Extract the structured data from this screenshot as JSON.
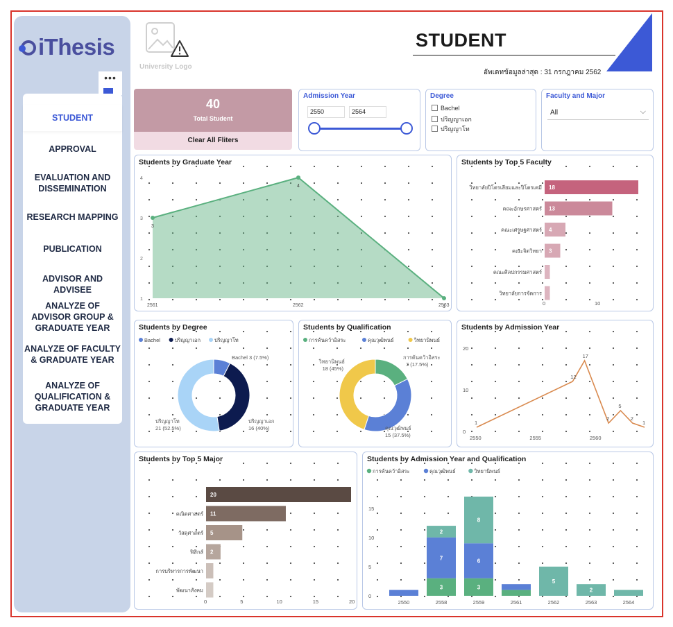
{
  "app": {
    "logo_text": "iThesis",
    "more_label": "•••",
    "university_logo": "University Logo",
    "page_title": "STUDENT",
    "updated_text": "อัพเดทข้อมูลล่าสุด : 31 กรกฎาคม 2562"
  },
  "nav": [
    {
      "label": "STUDENT",
      "active": true
    },
    {
      "label": "APPROVAL"
    },
    {
      "label": "EVALUATION AND DISSEMINATION"
    },
    {
      "label": "RESEARCH MAPPING"
    },
    {
      "label": "PUBLICATION"
    },
    {
      "label": "ADVISOR AND ADVISEE"
    },
    {
      "label": "ANALYZE OF ADVISOR GROUP & GRADUATE YEAR"
    },
    {
      "label": "ANALYZE OF FACULTY & GRADUATE YEAR"
    },
    {
      "label": "ANALYZE OF QUALIFICATION & GRADUATE YEAR"
    }
  ],
  "kpi": {
    "value": "40",
    "label": "Total Student",
    "clear_label": "Clear All Fliters"
  },
  "filters": {
    "admission": {
      "title": "Admission Year",
      "from": "2550",
      "to": "2564"
    },
    "degree": {
      "title": "Degree",
      "options": [
        "Bachel",
        "ปริญญาเอก",
        "ปริญญาโท"
      ]
    },
    "faculty": {
      "title": "Faculty and Major",
      "value": "All"
    }
  },
  "colors": {
    "accent": "#3c59d6",
    "kpi": "#c39aa5",
    "green": "#5ab07f",
    "navy": "#0d1b4f",
    "lightblue": "#a9d4f7",
    "blue": "#5b80d6",
    "yellow": "#f0c84a",
    "teal": "#6fb7a9",
    "orange": "#d98a4f",
    "brown": "#5a4a43"
  },
  "chart_data": [
    {
      "id": "graduate",
      "type": "area",
      "title": "Students by Graduate Year",
      "x": [
        "2561",
        "2562",
        "2563"
      ],
      "values": [
        3,
        4,
        1
      ],
      "yticks": [
        "1",
        "2",
        "3",
        "4"
      ],
      "ylim": [
        1,
        4
      ]
    },
    {
      "id": "faculty",
      "type": "bar",
      "orientation": "horizontal",
      "title": "Students by Top 5 Faculty",
      "categories": [
        "วิทยาลัยปิโตรเลียมและปิโตรเคมี",
        "คณะอักษรศาสตร์",
        "คณะเศรษฐศาสตร์",
        "คณะจิตวิทยา",
        "คณะศิลปกรรมศาสตร์",
        "วิทยาลัยการจัดการ"
      ],
      "values": [
        18,
        13,
        4,
        3,
        1,
        1
      ],
      "labels": [
        "18",
        "13",
        "4",
        "3",
        "",
        ""
      ],
      "xticks": [
        "0",
        "10"
      ],
      "xlim": [
        0,
        20
      ]
    },
    {
      "id": "degree",
      "type": "pie",
      "title": "Students by Degree",
      "legend": [
        "Bachel",
        "ปริญญาเอก",
        "ปริญญาโท"
      ],
      "values": [
        3,
        16,
        21
      ],
      "labels": [
        "Bachel 3 (7.5%)",
        "ปริญญาเอก",
        "16 (40%)",
        "ปริญญาโท",
        "21 (52.5%)"
      ]
    },
    {
      "id": "qualification",
      "type": "pie",
      "title": "Students by Qualification",
      "legend": [
        "การค้นคว้าอิสระ",
        "คุณวุฒิพนธ์",
        "วิทยานิพนธ์"
      ],
      "values": [
        7,
        15,
        18
      ],
      "labels": [
        "การค้นคว้าอิสระ",
        "7 (17.5%)",
        "คุณวุฒิพนธ์",
        "15 (37.5%)",
        "วิทยานิพนธ์",
        "18 (45%)"
      ]
    },
    {
      "id": "admission",
      "type": "line",
      "title": "Students by Admission Year",
      "x": [
        2550,
        2558,
        2559,
        2561,
        2562,
        2563,
        2564
      ],
      "values": [
        1,
        12,
        17,
        2,
        5,
        2,
        1
      ],
      "labels": [
        "1",
        "12",
        "17",
        "2",
        "5",
        "2",
        "1"
      ],
      "xticks": [
        "2550",
        "2555",
        "2560"
      ],
      "yticks": [
        "0",
        "10",
        "20"
      ],
      "ylim": [
        0,
        20
      ]
    },
    {
      "id": "major",
      "type": "bar",
      "orientation": "horizontal",
      "title": "Students by Top 5 Major",
      "categories": [
        "",
        "คณิตศาสตร์",
        "วัสดุศาสตร์",
        "ฟิสิกส์",
        "การบริหารการพัฒนา",
        "พัฒนาสังคม"
      ],
      "values": [
        20,
        11,
        5,
        2,
        1,
        1
      ],
      "labels": [
        "20",
        "11",
        "5",
        "2",
        "",
        ""
      ],
      "xticks": [
        "0",
        "5",
        "10",
        "15",
        "20"
      ],
      "xlim": [
        0,
        20
      ]
    },
    {
      "id": "stacked",
      "type": "bar",
      "stacked": true,
      "title": "Students by Admission Year and Qualification",
      "legend": [
        "การค้นคว้าอิสระ",
        "คุณวุฒิพนธ์",
        "วิทยานิพนธ์"
      ],
      "categories": [
        "2550",
        "2558",
        "2559",
        "2561",
        "2562",
        "2563",
        "2564"
      ],
      "series": [
        {
          "name": "การค้นคว้าอิสระ",
          "values": [
            0,
            3,
            3,
            1,
            0,
            0,
            0
          ]
        },
        {
          "name": "คุณวุฒิพนธ์",
          "values": [
            1,
            7,
            6,
            1,
            0,
            0,
            0
          ]
        },
        {
          "name": "วิทยานิพนธ์",
          "values": [
            0,
            2,
            8,
            0,
            5,
            2,
            1
          ]
        }
      ],
      "seglabels": [
        [
          "",
          "",
          "",
          ""
        ],
        [
          "3",
          "7",
          "2"
        ],
        [
          "3",
          "6",
          "8"
        ],
        [
          "",
          "",
          ""
        ],
        [
          "",
          "",
          "5"
        ],
        [
          "",
          "",
          "2"
        ],
        [
          "",
          "",
          ""
        ]
      ],
      "yticks": [
        "0",
        "5",
        "10",
        "15"
      ],
      "ylim": [
        0,
        17
      ]
    }
  ]
}
